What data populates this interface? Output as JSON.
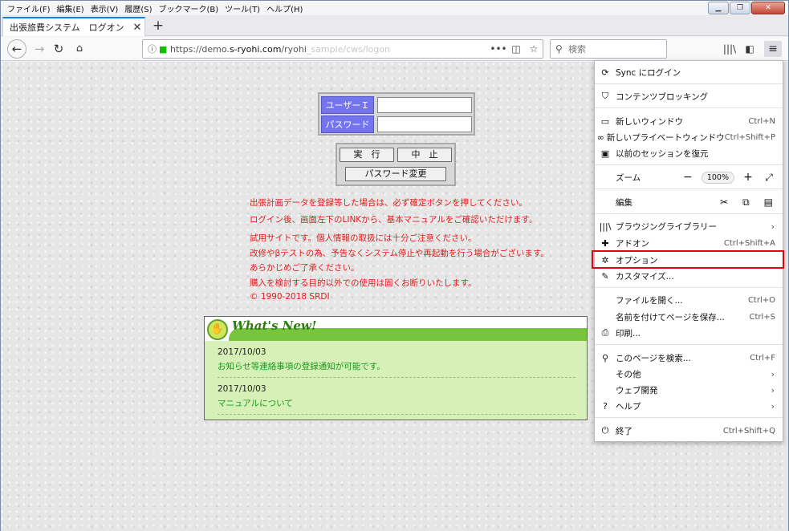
{
  "menubar": {
    "items": [
      "ファイル(F)",
      "編集(E)",
      "表示(V)",
      "履歴(S)",
      "ブックマーク(B)",
      "ツール(T)",
      "ヘルプ(H)"
    ]
  },
  "tab": {
    "title": "出張旅費システム　ログオン",
    "close": "✕"
  },
  "navbar": {
    "url_prefix": "https://demo.",
    "url_host": "s-ryohi.com",
    "url_path": "/ryohi",
    "url_blurred": "_sample/cws/logon",
    "search_placeholder": "検索"
  },
  "login": {
    "user_id_label": "ユーザーＩＤ",
    "password_label": "パスワード",
    "run_button": "実　行",
    "cancel_button": "中　止",
    "change_password_button": "パスワード変更"
  },
  "notices": [
    "出張計画データを登録等した場合は、必ず確定ボタンを押してください。",
    "ログイン後、画面左下のLINKから、基本マニュアルをご確認いただけます。",
    "試用サイトです。個人情報の取扱には十分ご注意ください。",
    "改修やβテストの為、予告なくシステム停止や再起動を行う場合がございます。",
    "あらかじめご了承ください。",
    "購入を検討する目的以外での使用は固くお断りいたします。",
    "© 1990-2018 SRDI"
  ],
  "whats_new": {
    "title": "What's New!",
    "items": [
      {
        "date": "2017/10/03",
        "text": "お知らせ等連絡事項の登録通知が可能です。"
      },
      {
        "date": "2017/10/03",
        "text": "マニュアルについて"
      }
    ]
  },
  "ffmenu": {
    "sync": "Sync にログイン",
    "content_blocking": "コンテンツブロッキング",
    "new_window": "新しいウィンドウ",
    "new_window_sc": "Ctrl+N",
    "new_private": "新しいプライベートウィンドウ",
    "new_private_sc": "Ctrl+Shift+P",
    "restore_session": "以前のセッションを復元",
    "zoom": "ズーム",
    "zoom_value": "100%",
    "edit": "編集",
    "library": "ブラウジングライブラリー",
    "addons": "アドオン",
    "addons_sc": "Ctrl+Shift+A",
    "options": "オプション",
    "customize": "カスタマイズ...",
    "open_file": "ファイルを開く...",
    "open_file_sc": "Ctrl+O",
    "save_page": "名前を付けてページを保存...",
    "save_page_sc": "Ctrl+S",
    "print": "印刷...",
    "find": "このページを検索...",
    "find_sc": "Ctrl+F",
    "more": "その他",
    "web_dev": "ウェブ開発",
    "help": "ヘルプ",
    "quit": "終了",
    "quit_sc": "Ctrl+Shift+Q"
  }
}
